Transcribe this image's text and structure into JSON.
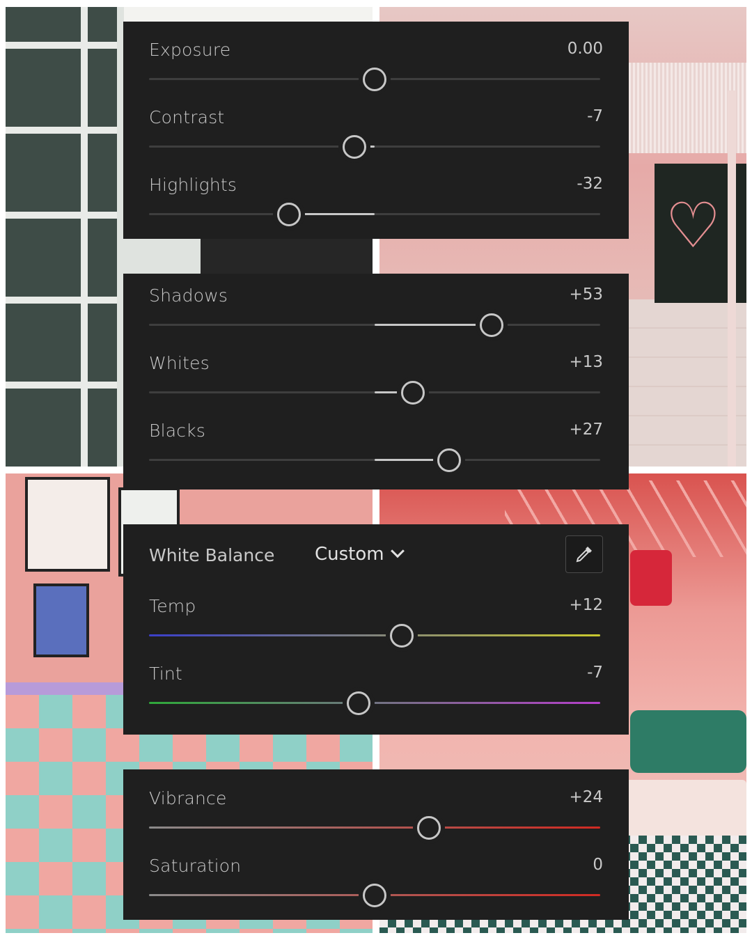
{
  "background_photos": [
    "photo-top-left",
    "photo-top-right",
    "photo-bottom-left",
    "photo-bottom-right"
  ],
  "light": {
    "sliders": [
      {
        "label": "Exposure",
        "value": "0.00",
        "position": 0.5,
        "fill_from": 0.5
      },
      {
        "label": "Contrast",
        "value": "-7",
        "position": 0.455,
        "fill_from": 0.5
      },
      {
        "label": "Highlights",
        "value": "-32",
        "position": 0.31,
        "fill_from": 0.5
      }
    ]
  },
  "tone": {
    "sliders": [
      {
        "label": "Shadows",
        "value": "+53",
        "position": 0.76,
        "fill_from": 0.5
      },
      {
        "label": "Whites",
        "value": "+13",
        "position": 0.585,
        "fill_from": 0.5
      },
      {
        "label": "Blacks",
        "value": "+27",
        "position": 0.665,
        "fill_from": 0.5
      }
    ]
  },
  "color": {
    "white_balance_label": "White Balance",
    "white_balance_value": "Custom",
    "picker_icon": "eyedropper-icon",
    "sliders": [
      {
        "label": "Temp",
        "value": "+12",
        "position": 0.56,
        "gradient": [
          "#3a3fc9",
          "#c9c92e"
        ]
      },
      {
        "label": "Tint",
        "value": "-7",
        "position": 0.465,
        "gradient": [
          "#2fa83a",
          "#b43fc9"
        ]
      }
    ]
  },
  "presence": {
    "sliders": [
      {
        "label": "Vibrance",
        "value": "+24",
        "position": 0.62,
        "gradient": [
          "#8a8a8a",
          "#d02a22"
        ]
      },
      {
        "label": "Saturation",
        "value": "0",
        "position": 0.5,
        "gradient": [
          "#8a8a8a",
          "#d02a22"
        ]
      }
    ]
  },
  "colors": {
    "panel_bg": "#1f1f1f",
    "text": "#c9c9c9",
    "thumb": "#c7c7c7",
    "track": "#3e3e3e"
  }
}
